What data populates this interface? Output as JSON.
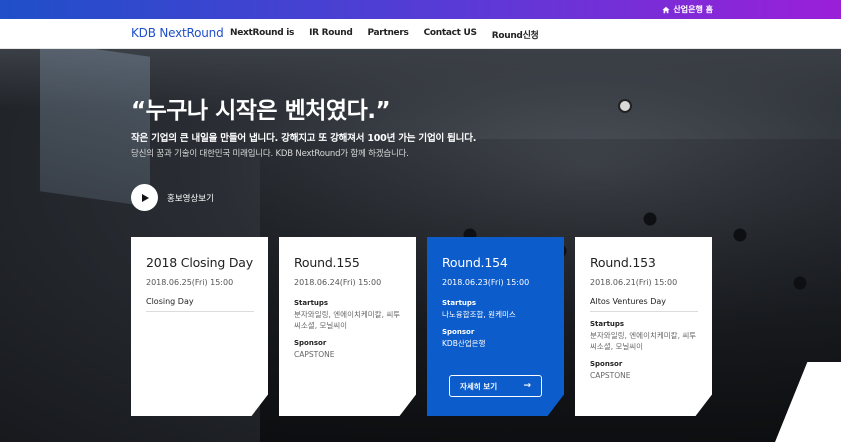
{
  "topbar": {
    "bank_link_label": "산업은행 홈"
  },
  "nav": {
    "logo": "KDB NextRound",
    "items": [
      "NextRound is",
      "IR Round",
      "Partners",
      "Contact US",
      "Round신청"
    ]
  },
  "hero": {
    "headline": "“누구나 시작은 벤처였다.”",
    "sub1": "작은 기업의 큰 내일을 만들어 냅니다. 강해지고 또 강해져서 100년 가는 기업이 됩니다.",
    "sub2": "당신의 꿈과 기술이 대한민국 미래입니다. KDB NextRound가 함께 하겠습니다.",
    "video_label": "홍보영상보기"
  },
  "cards": [
    {
      "title": "2018 Closing Day",
      "date": "2018.06.25(Fri) 15:00",
      "event": "Closing Day"
    },
    {
      "title": "Round.155",
      "date": "2018.06.24(Fri) 15:00",
      "startups_label": "Startups",
      "startups": "분자와일링, 엔에이치케미칼, 씨투씨소셜, 모닐씨이",
      "sponsor_label": "Sponsor",
      "sponsor": "CAPSTONE"
    },
    {
      "title": "Round.154",
      "date": "2018.06.23(Fri) 15:00",
      "startups_label": "Startups",
      "startups": "나노융합조합, 원케미스",
      "sponsor_label": "Sponsor",
      "sponsor": "KDB산업은행",
      "detail_label": "자세히 보기",
      "detail_arrow": "→"
    },
    {
      "title": "Round.153",
      "date": "2018.06.21(Fri) 15:00",
      "event": "Altos Ventures Day",
      "startups_label": "Startups",
      "startups": "분자와일링, 엔에이치케미칼, 씨투씨소셜, 모닐씨이",
      "sponsor_label": "Sponsor",
      "sponsor": "CAPSTONE"
    }
  ],
  "colors": {
    "brand_blue": "#1f4fc9",
    "active_card": "#0c5ccb",
    "topbar_end": "#9b1fd8"
  }
}
